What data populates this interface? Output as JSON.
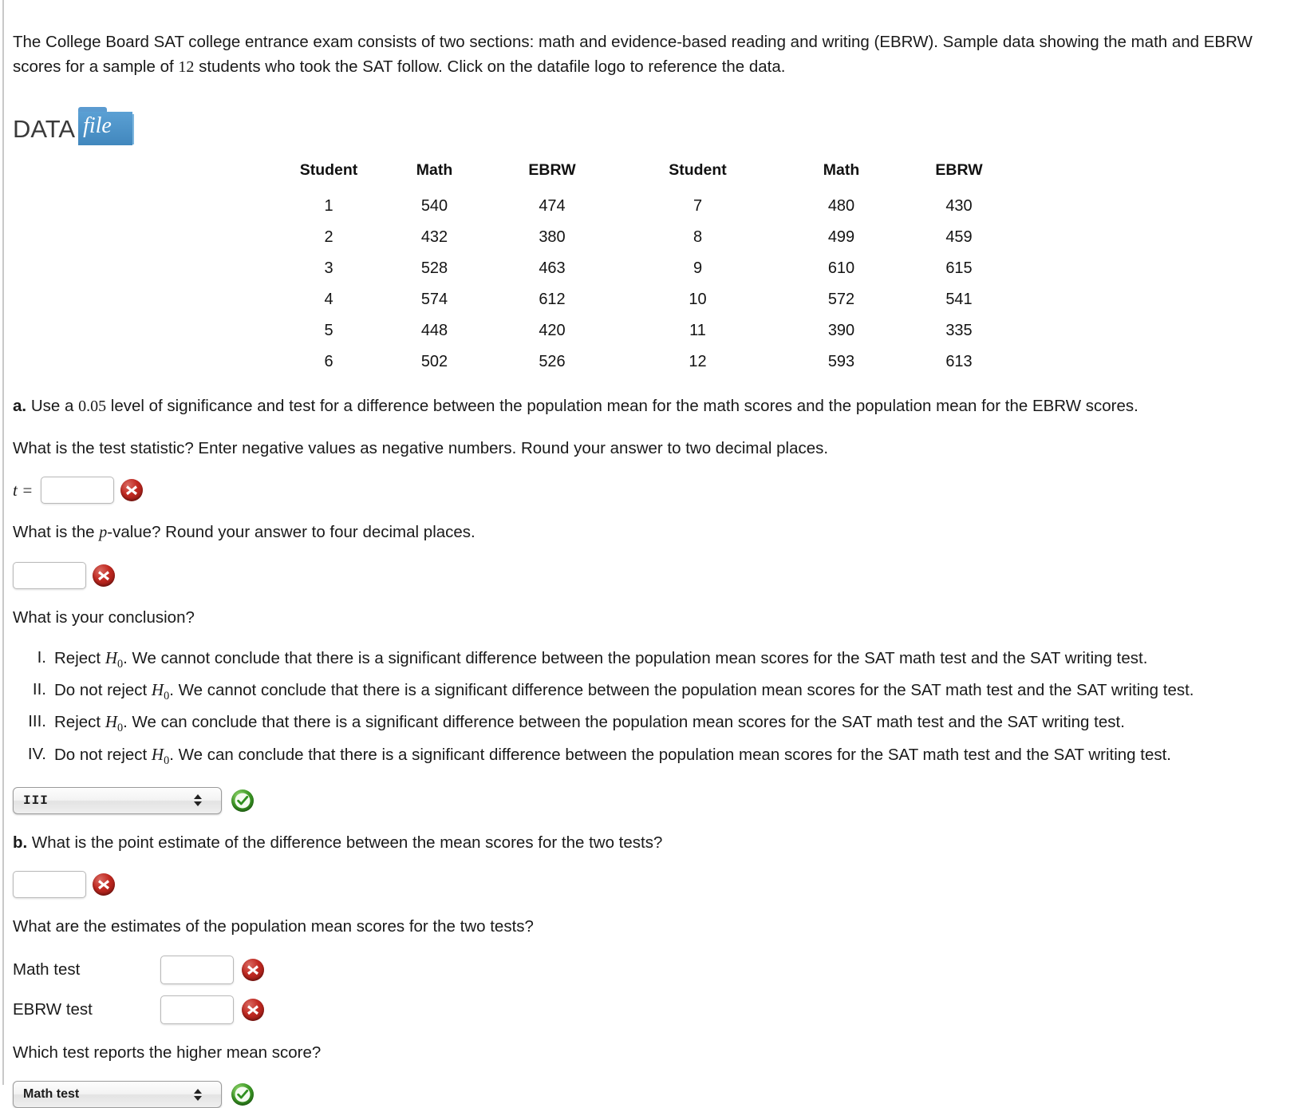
{
  "intro": {
    "text_part1": "The College Board SAT college entrance exam consists of two sections: math and evidence-based reading and writing (EBRW). Sample data showing the math and EBRW scores for a sample of ",
    "sample_size": "12",
    "text_part2": " students who took the SAT follow. Click on the datafile logo to reference the data."
  },
  "datafile_logo": {
    "text_main": "DATA",
    "text_badge": "file"
  },
  "table": {
    "headers": [
      "Student",
      "Math",
      "EBRW",
      "Student",
      "Math",
      "EBRW"
    ],
    "rows": [
      [
        "1",
        "540",
        "474",
        "7",
        "480",
        "430"
      ],
      [
        "2",
        "432",
        "380",
        "8",
        "499",
        "459"
      ],
      [
        "3",
        "528",
        "463",
        "9",
        "610",
        "615"
      ],
      [
        "4",
        "574",
        "612",
        "10",
        "572",
        "541"
      ],
      [
        "5",
        "448",
        "420",
        "11",
        "390",
        "335"
      ],
      [
        "6",
        "502",
        "526",
        "12",
        "593",
        "613"
      ]
    ]
  },
  "part_a": {
    "label": "a.",
    "prompt_before": "Use a ",
    "alpha": "0.05",
    "prompt_after": " level of significance and test for a difference between the population mean for the math scores and the population mean for the EBRW scores.",
    "test_statistic_prompt": "What is the test statistic? Enter negative values as negative numbers. Round your answer to two decimal places.",
    "t_symbol": "t =",
    "t_value": "",
    "pvalue_prompt_before": "What is the ",
    "pvalue_symbol": "p",
    "pvalue_prompt_after": "-value? Round your answer to four decimal places.",
    "pvalue_value": "",
    "conclusion_prompt": "What is your conclusion?",
    "options": [
      {
        "num": "I.",
        "before": "Reject ",
        "h": "H",
        "sub": "0",
        "after": ". We cannot conclude that there is a significant difference between the population mean scores for the SAT math test and the SAT writing test."
      },
      {
        "num": "II.",
        "before": "Do not reject ",
        "h": "H",
        "sub": "0",
        "after": ". We cannot conclude that there is a significant difference between the population mean scores for the SAT math test and the SAT writing test."
      },
      {
        "num": "III.",
        "before": "Reject ",
        "h": "H",
        "sub": "0",
        "after": ". We can conclude that there is a significant difference between the population mean scores for the SAT math test and the SAT writing test."
      },
      {
        "num": "IV.",
        "before": "Do not reject ",
        "h": "H",
        "sub": "0",
        "after": ". We can conclude that there is a significant difference between the population mean scores for the SAT math test and the SAT writing test."
      }
    ],
    "conclusion_select_value": "III",
    "conclusion_select_options": [
      "I",
      "II",
      "III",
      "IV"
    ],
    "conclusion_status": "correct"
  },
  "part_b": {
    "label": "b.",
    "prompt": "What is the point estimate of the difference between the mean scores for the two tests?",
    "point_estimate_value": "",
    "estimates_prompt": "What are the estimates of the population mean scores for the two tests?",
    "estimates": [
      {
        "label": "Math test",
        "value": "",
        "status": "incorrect"
      },
      {
        "label": "EBRW test",
        "value": "",
        "status": "incorrect"
      }
    ],
    "higher_mean_prompt": "Which test reports the higher mean score?",
    "higher_mean_select_value": "Math test",
    "higher_mean_select_options": [
      "Math test",
      "EBRW test"
    ],
    "higher_mean_status": "correct"
  },
  "status_icons": {
    "incorrect": "x-circle-icon",
    "correct": "check-circle-icon"
  }
}
